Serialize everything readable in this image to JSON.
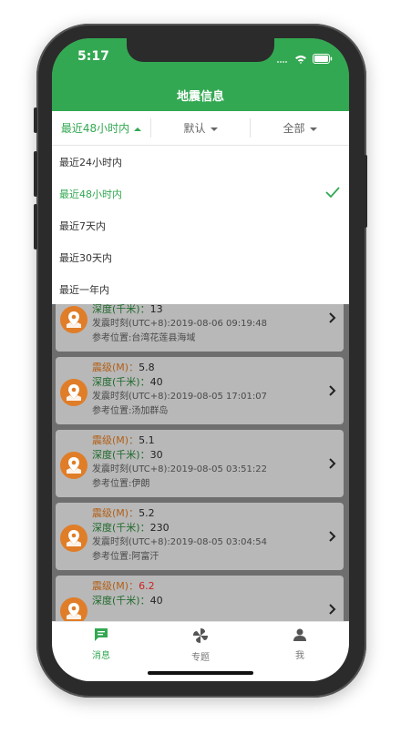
{
  "status_bar": {
    "time": "5:17"
  },
  "header": {
    "title": "地震信息"
  },
  "filters": [
    {
      "label": "最近48小时内",
      "active": true
    },
    {
      "label": "默认",
      "active": false
    },
    {
      "label": "全部",
      "active": false
    }
  ],
  "dropdown": {
    "options": [
      {
        "label": "最近24小时内",
        "selected": false
      },
      {
        "label": "最近48小时内",
        "selected": true
      },
      {
        "label": "最近7天内",
        "selected": false
      },
      {
        "label": "最近30天内",
        "selected": false
      },
      {
        "label": "最近一年内",
        "selected": false
      }
    ]
  },
  "labels": {
    "magnitude": "震级(M)：",
    "depth": "深度(千米)：",
    "time_prefix": "发震时刻(UTC+8):",
    "location_prefix": "参考位置:"
  },
  "quakes": [
    {
      "magnitude": "",
      "depth": "13",
      "time": "2019-08-06 09:19:48",
      "location": "台湾花莲县海域"
    },
    {
      "magnitude": "5.8",
      "depth": "40",
      "time": "2019-08-05 17:01:07",
      "location": "汤加群岛"
    },
    {
      "magnitude": "5.1",
      "depth": "30",
      "time": "2019-08-05 03:51:22",
      "location": "伊朗"
    },
    {
      "magnitude": "5.2",
      "depth": "230",
      "time": "2019-08-05 03:04:54",
      "location": "阿富汗"
    },
    {
      "magnitude": "6.2",
      "depth": "40",
      "time": "",
      "location": "",
      "highlight": true
    }
  ],
  "tabs": [
    {
      "label": "消息",
      "icon": "message-icon",
      "active": true
    },
    {
      "label": "专题",
      "icon": "pinwheel-icon",
      "active": false
    },
    {
      "label": "我",
      "icon": "person-icon",
      "active": false
    }
  ],
  "colors": {
    "brand": "#33a852",
    "accent": "#e07d28",
    "overlay": "#6e6e6e"
  }
}
